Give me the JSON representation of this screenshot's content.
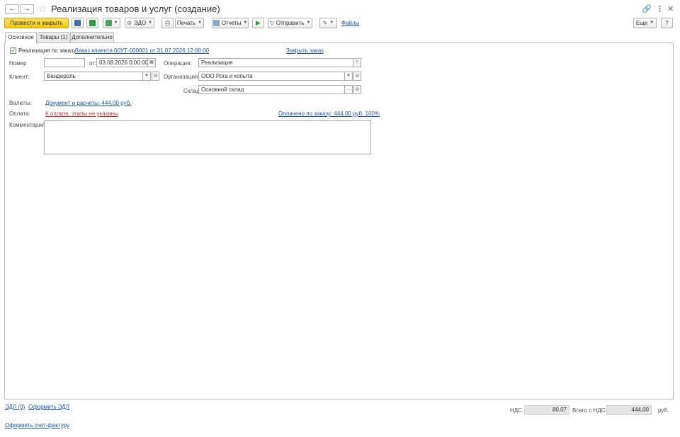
{
  "window": {
    "title": "Реализация товаров и услуг (создание)"
  },
  "icons": {
    "back": "arrow-left-icon",
    "forward": "arrow-right-icon",
    "favorite": "star-icon",
    "link": "link-icon",
    "more": "kebab-icon",
    "close": "close-icon"
  },
  "toolbar": {
    "post_close": "Провести и закрыть",
    "edo": "ЭДО",
    "print": "Печать",
    "reports": "Отчеты",
    "send": "Отправить",
    "files": "Файлы",
    "more": "Еще",
    "help": "?"
  },
  "tabs": [
    {
      "label": "Основное"
    },
    {
      "label": "Товары (1)"
    },
    {
      "label": "Дополнительно"
    }
  ],
  "form": {
    "by_order_label": "Реализация по заказу",
    "by_order_checked": true,
    "order_link": "Заказ клиента 00УТ-000001 от 31.07.2026 12:00:00",
    "close_order": "Закрыть заказ",
    "number_label": "Номер",
    "number_value": "",
    "date_label": "от:",
    "date_value": "03.08.2026  0:00:00",
    "operation_label": "Операция:",
    "operation_value": "Реализация",
    "client_label": "Клиент:",
    "client_value": "Бандероль",
    "organization_label": "Организация:",
    "organization_value": "ООО Рога и копыта",
    "warehouse_label": "Склад:",
    "warehouse_value": "Основной склад",
    "currency_label": "Валюты:",
    "currency_link": "Документ и расчеты: 444,00 руб.",
    "payment_label": "Оплата:",
    "payment_link": "К оплате, этапы не указаны",
    "paid_link": "Оплачено по заказу: 444,00 руб. 100%",
    "comment_label": "Комментарий:",
    "comment_value": ""
  },
  "footer": {
    "edl": "ЭДЛ (0)",
    "edl_issue": "Оформить ЭДЛ",
    "invoice": "Оформить счет-фактуру",
    "vat_label": "НДС:",
    "vat_value": "80,07",
    "total_label": "Всего с НДС:",
    "total_value": "444,00",
    "currency": "руб."
  },
  "colors": {
    "primary_button": "#f2c80c",
    "link": "#1b57b1",
    "link_warning": "#c0362c"
  }
}
